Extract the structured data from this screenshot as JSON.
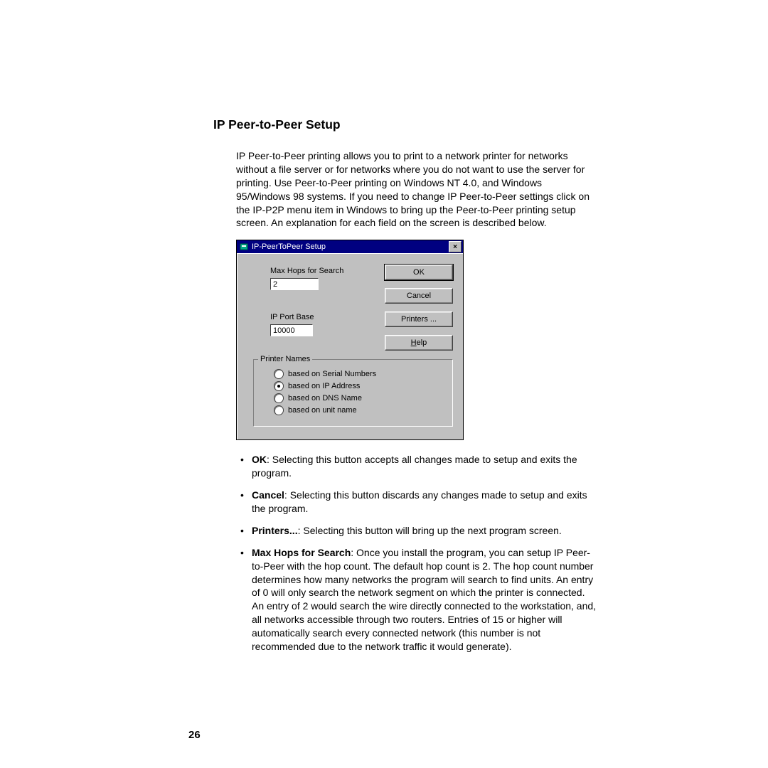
{
  "heading": "IP Peer-to-Peer Setup",
  "intro": "IP Peer-to-Peer printing allows you to print to a network printer for networks without a file server or for networks where you do not want to use the server for printing. Use Peer-to-Peer printing on Windows NT 4.0, and Windows 95/Windows 98 systems. If you need to change IP Peer-to-Peer settings click on the IP-P2P menu item in Windows to bring up the Peer-to-Peer printing setup screen. An explanation for each field on the screen is described below.",
  "dialog": {
    "title": "IP-PeerToPeer Setup",
    "close_icon": "×",
    "max_hops_label": "Max Hops for Search",
    "max_hops_value": "2",
    "ip_port_base_label": "IP Port Base",
    "ip_port_base_value": "10000",
    "buttons": {
      "ok": "OK",
      "cancel": "Cancel",
      "printers": "Printers ...",
      "help_pre": "",
      "help_accel": "H",
      "help_post": "elp"
    },
    "group_label": "Printer Names",
    "radios": [
      {
        "label": "based on Serial Numbers",
        "selected": false
      },
      {
        "label": "based on IP Address",
        "selected": true
      },
      {
        "label": "based on DNS Name",
        "selected": false
      },
      {
        "label": "based on unit name",
        "selected": false
      }
    ]
  },
  "bullets": {
    "ok": {
      "term": "OK",
      "text": ": Selecting this button accepts all changes made to setup and exits the program."
    },
    "cancel": {
      "term": "Cancel",
      "text": ": Selecting this button discards any changes made to setup and exits the program."
    },
    "printers": {
      "term": "Printers...",
      "text": ": Selecting this button will bring up the next program screen."
    },
    "maxhops": {
      "term": "Max Hops for Search",
      "text": ": Once you install the program, you can setup IP Peer-to-Peer with the hop count. The default hop count is 2. The hop count number determines how many networks the program will search to find units. An entry of 0 will only search the network segment on which the printer is connected. An entry of 2 would search the wire directly connected to the workstation, and, all networks accessible through two routers. Entries of 15 or higher will automatically search every connected network (this number is not recommended due to the network traffic it would generate)."
    }
  },
  "page_number": "26"
}
